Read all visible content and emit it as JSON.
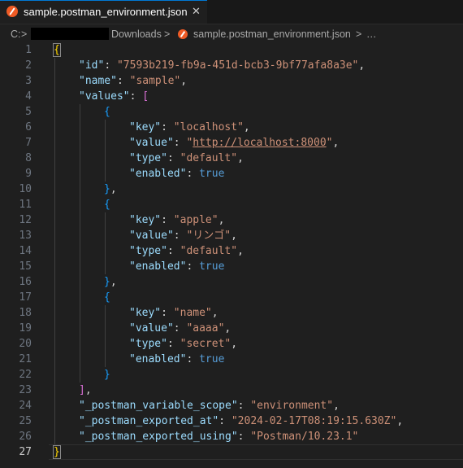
{
  "tab": {
    "icon": "postman-icon",
    "title": "sample.postman_environment.json",
    "close": "✕"
  },
  "breadcrumb": {
    "drive": "C:",
    "folder": "Downloads",
    "file": "sample.postman_environment.json",
    "more": "…",
    "separator": ">"
  },
  "editor": {
    "active_line": 27,
    "lines": [
      {
        "n": "1",
        "indent": 0,
        "tokens": [
          {
            "t": "{",
            "c": "br1 bracket-hl"
          }
        ]
      },
      {
        "n": "2",
        "indent": 1,
        "tokens": [
          {
            "t": "\"id\"",
            "c": "k"
          },
          {
            "t": ": ",
            "c": "p"
          },
          {
            "t": "\"7593b219-fb9a-451d-bcb3-9bf77afa8a3e\"",
            "c": "s"
          },
          {
            "t": ",",
            "c": "p"
          }
        ]
      },
      {
        "n": "3",
        "indent": 1,
        "tokens": [
          {
            "t": "\"name\"",
            "c": "k"
          },
          {
            "t": ": ",
            "c": "p"
          },
          {
            "t": "\"sample\"",
            "c": "s"
          },
          {
            "t": ",",
            "c": "p"
          }
        ]
      },
      {
        "n": "4",
        "indent": 1,
        "tokens": [
          {
            "t": "\"values\"",
            "c": "k"
          },
          {
            "t": ": ",
            "c": "p"
          },
          {
            "t": "[",
            "c": "br2"
          }
        ]
      },
      {
        "n": "5",
        "indent": 2,
        "tokens": [
          {
            "t": "{",
            "c": "br3"
          }
        ]
      },
      {
        "n": "6",
        "indent": 3,
        "tokens": [
          {
            "t": "\"key\"",
            "c": "k"
          },
          {
            "t": ": ",
            "c": "p"
          },
          {
            "t": "\"localhost\"",
            "c": "s"
          },
          {
            "t": ",",
            "c": "p"
          }
        ]
      },
      {
        "n": "7",
        "indent": 3,
        "tokens": [
          {
            "t": "\"value\"",
            "c": "k"
          },
          {
            "t": ": ",
            "c": "p"
          },
          {
            "t": "\"",
            "c": "s"
          },
          {
            "t": "http://localhost:8000",
            "c": "s link"
          },
          {
            "t": "\"",
            "c": "s"
          },
          {
            "t": ",",
            "c": "p"
          }
        ]
      },
      {
        "n": "8",
        "indent": 3,
        "tokens": [
          {
            "t": "\"type\"",
            "c": "k"
          },
          {
            "t": ": ",
            "c": "p"
          },
          {
            "t": "\"default\"",
            "c": "s"
          },
          {
            "t": ",",
            "c": "p"
          }
        ]
      },
      {
        "n": "9",
        "indent": 3,
        "tokens": [
          {
            "t": "\"enabled\"",
            "c": "k"
          },
          {
            "t": ": ",
            "c": "p"
          },
          {
            "t": "true",
            "c": "b"
          }
        ]
      },
      {
        "n": "10",
        "indent": 2,
        "tokens": [
          {
            "t": "}",
            "c": "br3"
          },
          {
            "t": ",",
            "c": "p"
          }
        ]
      },
      {
        "n": "11",
        "indent": 2,
        "tokens": [
          {
            "t": "{",
            "c": "br3"
          }
        ]
      },
      {
        "n": "12",
        "indent": 3,
        "tokens": [
          {
            "t": "\"key\"",
            "c": "k"
          },
          {
            "t": ": ",
            "c": "p"
          },
          {
            "t": "\"apple\"",
            "c": "s"
          },
          {
            "t": ",",
            "c": "p"
          }
        ]
      },
      {
        "n": "13",
        "indent": 3,
        "tokens": [
          {
            "t": "\"value\"",
            "c": "k"
          },
          {
            "t": ": ",
            "c": "p"
          },
          {
            "t": "\"リンゴ\"",
            "c": "s"
          },
          {
            "t": ",",
            "c": "p"
          }
        ]
      },
      {
        "n": "14",
        "indent": 3,
        "tokens": [
          {
            "t": "\"type\"",
            "c": "k"
          },
          {
            "t": ": ",
            "c": "p"
          },
          {
            "t": "\"default\"",
            "c": "s"
          },
          {
            "t": ",",
            "c": "p"
          }
        ]
      },
      {
        "n": "15",
        "indent": 3,
        "tokens": [
          {
            "t": "\"enabled\"",
            "c": "k"
          },
          {
            "t": ": ",
            "c": "p"
          },
          {
            "t": "true",
            "c": "b"
          }
        ]
      },
      {
        "n": "16",
        "indent": 2,
        "tokens": [
          {
            "t": "}",
            "c": "br3"
          },
          {
            "t": ",",
            "c": "p"
          }
        ]
      },
      {
        "n": "17",
        "indent": 2,
        "tokens": [
          {
            "t": "{",
            "c": "br3"
          }
        ]
      },
      {
        "n": "18",
        "indent": 3,
        "tokens": [
          {
            "t": "\"key\"",
            "c": "k"
          },
          {
            "t": ": ",
            "c": "p"
          },
          {
            "t": "\"name\"",
            "c": "s"
          },
          {
            "t": ",",
            "c": "p"
          }
        ]
      },
      {
        "n": "19",
        "indent": 3,
        "tokens": [
          {
            "t": "\"value\"",
            "c": "k"
          },
          {
            "t": ": ",
            "c": "p"
          },
          {
            "t": "\"aaaa\"",
            "c": "s"
          },
          {
            "t": ",",
            "c": "p"
          }
        ]
      },
      {
        "n": "20",
        "indent": 3,
        "tokens": [
          {
            "t": "\"type\"",
            "c": "k"
          },
          {
            "t": ": ",
            "c": "p"
          },
          {
            "t": "\"secret\"",
            "c": "s"
          },
          {
            "t": ",",
            "c": "p"
          }
        ]
      },
      {
        "n": "21",
        "indent": 3,
        "tokens": [
          {
            "t": "\"enabled\"",
            "c": "k"
          },
          {
            "t": ": ",
            "c": "p"
          },
          {
            "t": "true",
            "c": "b"
          }
        ]
      },
      {
        "n": "22",
        "indent": 2,
        "tokens": [
          {
            "t": "}",
            "c": "br3"
          }
        ]
      },
      {
        "n": "23",
        "indent": 1,
        "tokens": [
          {
            "t": "]",
            "c": "br2"
          },
          {
            "t": ",",
            "c": "p"
          }
        ]
      },
      {
        "n": "24",
        "indent": 1,
        "tokens": [
          {
            "t": "\"_postman_variable_scope\"",
            "c": "k"
          },
          {
            "t": ": ",
            "c": "p"
          },
          {
            "t": "\"environment\"",
            "c": "s"
          },
          {
            "t": ",",
            "c": "p"
          }
        ]
      },
      {
        "n": "25",
        "indent": 1,
        "tokens": [
          {
            "t": "\"_postman_exported_at\"",
            "c": "k"
          },
          {
            "t": ": ",
            "c": "p"
          },
          {
            "t": "\"2024-02-17T08:19:15.630Z\"",
            "c": "s"
          },
          {
            "t": ",",
            "c": "p"
          }
        ]
      },
      {
        "n": "26",
        "indent": 1,
        "tokens": [
          {
            "t": "\"_postman_exported_using\"",
            "c": "k"
          },
          {
            "t": ": ",
            "c": "p"
          },
          {
            "t": "\"Postman/10.23.1\"",
            "c": "s"
          }
        ]
      },
      {
        "n": "27",
        "indent": 0,
        "tokens": [
          {
            "t": "}",
            "c": "br1 bracket-hl"
          }
        ]
      }
    ]
  }
}
